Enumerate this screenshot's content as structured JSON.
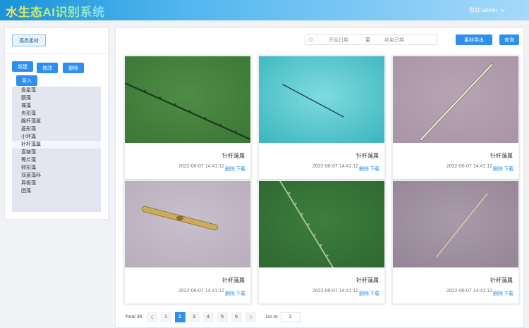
{
  "header": {
    "title": "水生态AI识别系统",
    "user_greeting": "您好:admin"
  },
  "left": {
    "category_tab": "藻类素材",
    "buttons": {
      "add": "新建",
      "edit": "修改",
      "delete": "删除",
      "import": "导入"
    },
    "tree": [
      {
        "label": "盘星藻"
      },
      {
        "label": "颤藻"
      },
      {
        "label": "裸藻"
      },
      {
        "label": "舟形藻"
      },
      {
        "label": "脆杆藻属"
      },
      {
        "label": "菱形藻"
      },
      {
        "label": "小环藻"
      },
      {
        "label": "针杆藻属",
        "selected": true
      },
      {
        "label": "直链藻"
      },
      {
        "label": "等片藻"
      },
      {
        "label": "卵形藻"
      },
      {
        "label": "双菱藻科"
      },
      {
        "label": "异极藻"
      },
      {
        "label": "团藻"
      }
    ]
  },
  "toolbar": {
    "date_start_placeholder": "开始日期",
    "date_separator": "至",
    "date_end_placeholder": "结束日期",
    "export": "素材导出",
    "search": "查询"
  },
  "cards": [
    {
      "name": "针杆藻属",
      "time": "2022-06-07 14:41:12",
      "delete": "删除",
      "download": "下载",
      "image": "green"
    },
    {
      "name": "针杆藻属",
      "time": "2022-06-07 14:41:12",
      "delete": "删除",
      "download": "下载",
      "image": "cyan"
    },
    {
      "name": "针杆藻属",
      "time": "2022-06-07 14:41:12",
      "delete": "删除",
      "download": "下载",
      "image": "mauve"
    },
    {
      "name": "针杆藻属",
      "time": "2022-06-07 14:41:12",
      "delete": "删除",
      "download": "下载",
      "image": "pale"
    },
    {
      "name": "针杆藻属",
      "time": "2022-06-07 14:41:12",
      "delete": "删除",
      "download": "下载",
      "image": "green2"
    },
    {
      "name": "针杆藻属",
      "time": "2022-06-07 14:41:12",
      "delete": "删除",
      "download": "下载",
      "image": "mauve2"
    }
  ],
  "pagination": {
    "total": "Total 36",
    "pages": [
      "1",
      "2",
      "3",
      "4",
      "5",
      "6"
    ],
    "current_page": "2",
    "goto_label": "Go to",
    "goto_value": "2"
  },
  "colors": {
    "primary": "#2e8ff0",
    "header_start": "#1a93d8",
    "header_end": "#a6d9fa",
    "tree_bg": "#e3e5f1"
  }
}
